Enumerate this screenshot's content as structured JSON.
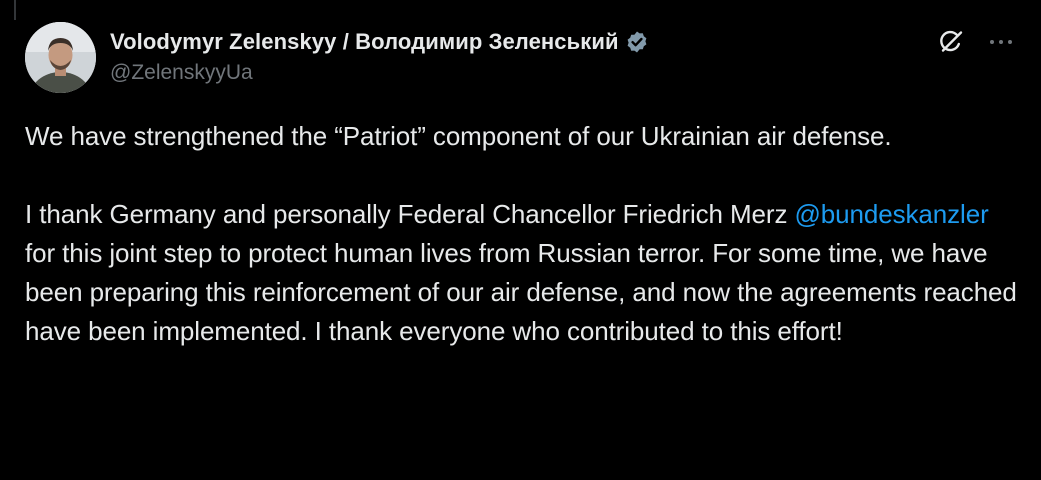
{
  "author": {
    "display_name": "Volodymyr Zelenskyy / Володимир Зеленський",
    "handle": "@ZelenskyyUa",
    "verified": true,
    "avatar_icon": "person-avatar"
  },
  "actions": {
    "grok_icon": "grok-icon",
    "more_icon": "more-dots-icon"
  },
  "tweet": {
    "paragraph1": "We have strengthened the “Patriot” component of our Ukrainian air defense.",
    "paragraph2_before_mention": "I thank Germany and personally Federal Chancellor Friedrich Merz ",
    "mention": "@bundeskanzler",
    "paragraph2_after_mention": " for this joint step to protect human lives from Russian terror. For some time, we have been preparing this reinforcement of our air defense, and now the agreements reached have been implemented. I thank everyone who contributed to this effort!"
  },
  "colors": {
    "background": "#000000",
    "text": "#e7e9ea",
    "secondary_text": "#71767b",
    "link": "#1d9bf0",
    "badge": "#829aab"
  }
}
